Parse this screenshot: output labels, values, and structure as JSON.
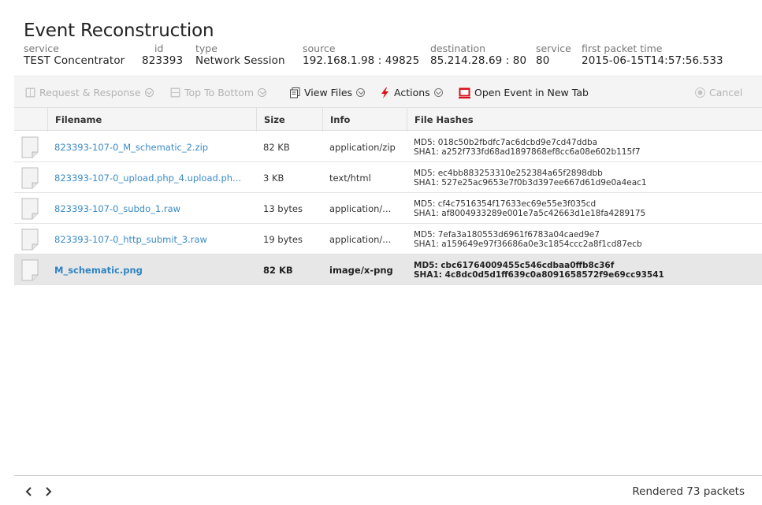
{
  "title": "Event Reconstruction",
  "meta": [
    {
      "label": "service",
      "value": "TEST Concentrator"
    },
    {
      "label": "id",
      "value": "823393"
    },
    {
      "label": "type",
      "value": "Network Session"
    },
    {
      "label": "source",
      "value": "192.168.1.98 : 49825"
    },
    {
      "label": "destination",
      "value": "85.214.28.69 : 80"
    },
    {
      "label": "service",
      "value": "80"
    },
    {
      "label": "first packet time",
      "value": "2015-06-15T14:57:56.533"
    }
  ],
  "toolbar": {
    "request_response": "Request & Response",
    "top_to_bottom": "Top To Bottom",
    "view_files": "View Files",
    "actions": "Actions",
    "open_new_tab": "Open Event in New Tab",
    "cancel": "Cancel"
  },
  "colors": {
    "link": "#3a8bc7",
    "accent_red": "#d6121a",
    "selected_row": "#e7e7e7"
  },
  "table": {
    "headers": [
      "Filename",
      "Size",
      "Info",
      "File Hashes"
    ],
    "rows": [
      {
        "filename": "823393-107-0_M_schematic_2.zip",
        "size": "82 KB",
        "info": "application/zip",
        "md5": "MD5: 018c50b2fbdfc7ac6dcbd9e7cd47ddba",
        "sha1": "SHA1: a252f733fd68ad1897868ef8cc6a08e602b115f7"
      },
      {
        "filename": "823393-107-0_upload.php_4.upload.ph...",
        "size": "3 KB",
        "info": "text/html",
        "md5": "MD5: ec4bb883253310e252384a65f2898dbb",
        "sha1": "SHA1: 527e25ac9653e7f0b3d397ee667d61d9e0a4eac1"
      },
      {
        "filename": "823393-107-0_subdo_1.raw",
        "size": "13 bytes",
        "info": "application/...",
        "md5": "MD5: cf4c7516354f17633ec69e55e3f035cd",
        "sha1": "SHA1: af8004933289e001e7a5c42663d1e18fa4289175"
      },
      {
        "filename": "823393-107-0_http_submit_3.raw",
        "size": "19 bytes",
        "info": "application/...",
        "md5": "MD5: 7efa3a180553d6961f6783a04caed9e7",
        "sha1": "SHA1: a159649e97f36686a0e3c1854ccc2a8f1cd87ecb"
      },
      {
        "filename": "M_schematic.png",
        "size": "82 KB",
        "info": "image/x-png",
        "md5": "MD5: cbc61764009455c546cdbaa0ffb8c36f",
        "sha1": "SHA1: 4c8dc0d5d1ff639c0a8091658572f9e69cc93541"
      }
    ]
  },
  "footer": {
    "status": "Rendered 73 packets"
  }
}
